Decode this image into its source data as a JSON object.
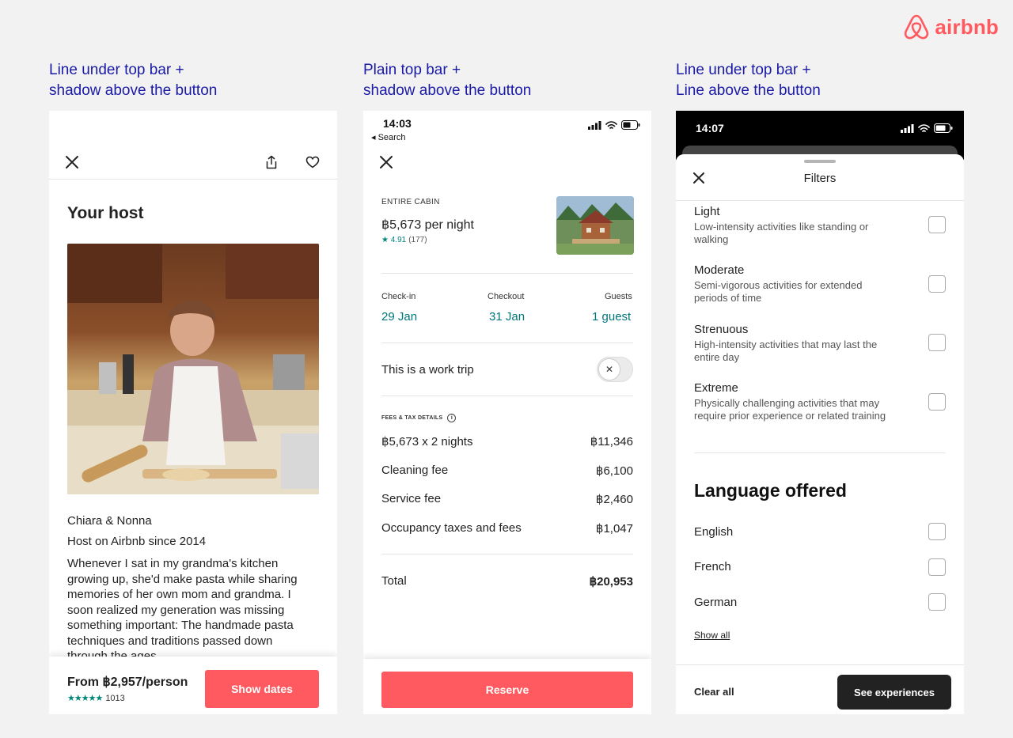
{
  "brand": {
    "name": "airbnb",
    "color": "#ff5a5f"
  },
  "captions": [
    {
      "line1": "Line under top bar +",
      "line2": "shadow above the button"
    },
    {
      "line1": "Plain top bar +",
      "line2": "shadow above the button"
    },
    {
      "line1": "Line under top bar +",
      "line2": "Line above the button"
    }
  ],
  "panel1": {
    "icons": [
      "close-icon",
      "share-icon",
      "heart-icon"
    ],
    "heading": "Your host",
    "host_name": "Chiara & Nonna",
    "host_since": "Host on Airbnb since 2014",
    "bio": "Whenever I sat in my grandma's kitchen growing up, she'd make pasta while sharing memories of her own mom and grandma. I soon realized my generation was missing something important: The handmade pasta techniques and traditions passed down through the ages.",
    "price": "From ฿2,957/person",
    "stars": "★★★★★",
    "review_count": "1013",
    "cta": "Show dates",
    "accent": "#ff5a5f",
    "star_color": "#00857a"
  },
  "panel2": {
    "status_time": "14:03",
    "status_back": "◂ Search",
    "listing_type": "ENTIRE CABIN",
    "price_per_night": "฿5,673 per night",
    "rating": "★ 4.91",
    "rating_count": "(177)",
    "checkin_label": "Check-in",
    "checkin_value": "29 Jan",
    "checkout_label": "Checkout",
    "checkout_value": "31 Jan",
    "guests_label": "Guests",
    "guests_value": "1 guest",
    "work_trip_label": "This is a work trip",
    "work_trip_enabled": false,
    "fees_label": "FEES & TAX DETAILS",
    "fees": [
      {
        "label": "฿5,673 x 2 nights",
        "amount": "฿11,346"
      },
      {
        "label": "Cleaning fee",
        "amount": "฿6,100"
      },
      {
        "label": "Service fee",
        "amount": "฿2,460"
      },
      {
        "label": "Occupancy taxes and fees",
        "amount": "฿1,047"
      }
    ],
    "total_label": "Total",
    "total_amount": "฿20,953",
    "cta": "Reserve",
    "teal": "#00757a"
  },
  "panel3": {
    "status_time": "14:07",
    "title": "Filters",
    "options": [
      {
        "title": "Light",
        "desc": "Low-intensity activities like standing or walking",
        "checked": false
      },
      {
        "title": "Moderate",
        "desc": "Semi-vigorous activities for extended periods of time",
        "checked": false
      },
      {
        "title": "Strenuous",
        "desc": "High-intensity activities that may last the entire day",
        "checked": false
      },
      {
        "title": "Extreme",
        "desc": "Physically challenging activities that may require prior experience or related training",
        "checked": false
      }
    ],
    "language_heading": "Language offered",
    "languages": [
      {
        "label": "English",
        "checked": false
      },
      {
        "label": "French",
        "checked": false
      },
      {
        "label": "German",
        "checked": false
      }
    ],
    "show_all": "Show all",
    "clear_all": "Clear all",
    "cta": "See experiences",
    "cta_color": "#222222"
  }
}
